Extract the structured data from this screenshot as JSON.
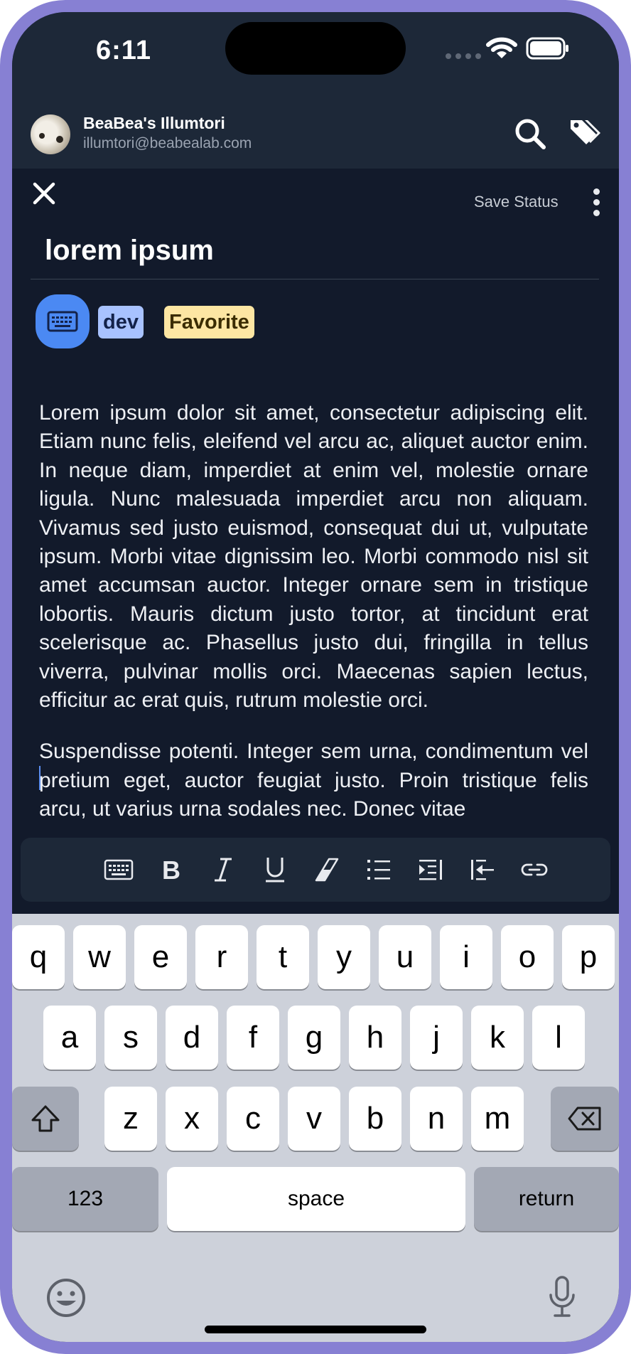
{
  "status_bar": {
    "time": "6:11"
  },
  "account": {
    "name": "BeaBea's Illumtori",
    "email": "illumtori@beabealab.com"
  },
  "editor": {
    "save_status": "Save Status",
    "title": "lorem ipsum",
    "tags": [
      "dev",
      "Favorite"
    ],
    "paragraphs": [
      "Lorem ipsum dolor sit amet, consectetur adipiscing elit. Etiam nunc felis, eleifend vel arcu ac, aliquet auctor enim. In neque diam, imperdiet at enim vel, molestie ornare ligula. Nunc malesuada imperdiet arcu non aliquam. Vivamus sed justo euismod, consequat dui ut, vulputate ipsum. Morbi vitae dignissim leo. Morbi commodo nisl sit amet accumsan auctor. Integer ornare sem in tristique lobortis. Mauris dictum justo tortor, at tincidunt erat scelerisque ac. Phasellus justo dui, fringilla in tellus viverra, pulvinar mollis orci. Maecenas sapien lectus, efficitur ac erat quis, rutrum molestie orci.",
      "Suspendisse potenti. Integer sem urna, condimentum vel pretium eget, auctor feugiat justo. Proin tristique felis arcu, ut varius urna sodales nec. Donec vitae"
    ]
  },
  "format_toolbar": [
    "keyboard-icon",
    "bold-icon",
    "italic-icon",
    "underline-icon",
    "eraser-icon",
    "list-icon",
    "indent-icon",
    "outdent-icon",
    "link-icon"
  ],
  "keyboard": {
    "row1": [
      "q",
      "w",
      "e",
      "r",
      "t",
      "y",
      "u",
      "i",
      "o",
      "p"
    ],
    "row2": [
      "a",
      "s",
      "d",
      "f",
      "g",
      "h",
      "j",
      "k",
      "l"
    ],
    "row3": [
      "z",
      "x",
      "c",
      "v",
      "b",
      "n",
      "m"
    ],
    "numbers": "123",
    "space": "space",
    "return": "return"
  },
  "colors": {
    "accent": "#4b89f3",
    "frame": "#8780d3",
    "tag_dev": "#a8c2ff",
    "tag_favorite": "#fde6a3",
    "background": "#121a2b"
  }
}
